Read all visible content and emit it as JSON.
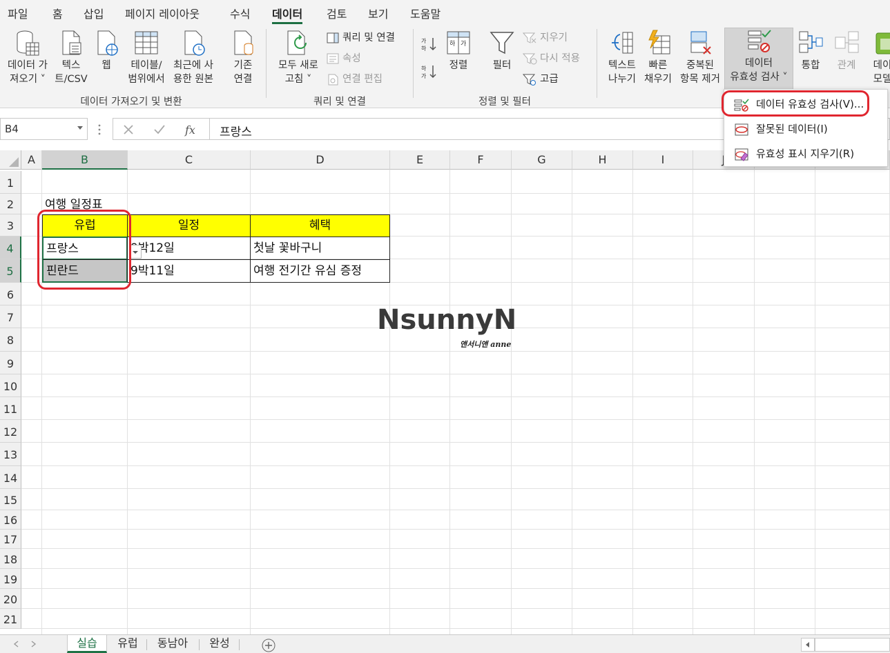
{
  "menu": {
    "tabs": [
      "파일",
      "홈",
      "삽입",
      "페이지 레이아웃",
      "수식",
      "데이터",
      "검토",
      "보기",
      "도움말"
    ],
    "active": "데이터"
  },
  "ribbon": {
    "get_data": [
      "데이터 가",
      "져오기 ˅"
    ],
    "text_csv": [
      "텍스",
      "트/CSV"
    ],
    "web": "웹",
    "table_range": [
      "테이블/",
      "범위에서"
    ],
    "recent_sources": [
      "최근에 사",
      "용한 원본"
    ],
    "existing_conn": [
      "기존",
      "연결"
    ],
    "group_get_transform": "데이터 가져오기 및 변환",
    "refresh_all": [
      "모두 새로",
      "고침 ˅"
    ],
    "queries_conn": "쿼리 및 연결",
    "properties": "속성",
    "edit_links": "연결 편집",
    "group_queries": "쿼리 및 연결",
    "sort": "정렬",
    "filter": "필터",
    "clear": "지우기",
    "reapply": "다시 적용",
    "advanced": "고급",
    "group_sort_filter": "정렬 및 필터",
    "text_to_columns": [
      "텍스트",
      "나누기"
    ],
    "flash_fill": [
      "빠른",
      "채우기"
    ],
    "remove_duplicates": [
      "중복된",
      "항목 제거"
    ],
    "data_validation": [
      "데이터",
      "유효성 검사 ˅"
    ],
    "consolidate": "통합",
    "relationships": "관계",
    "data_model": [
      "데이",
      "모델"
    ]
  },
  "formula_bar": {
    "name_box": "B4",
    "formula": "프랑스"
  },
  "columns": [
    "A",
    "B",
    "C",
    "D",
    "E",
    "F",
    "G",
    "H",
    "I",
    "J"
  ],
  "rows": [
    "1",
    "2",
    "3",
    "4",
    "5",
    "6",
    "7",
    "8",
    "9",
    "10",
    "11",
    "12",
    "13",
    "14",
    "15",
    "16",
    "17",
    "18",
    "19",
    "20",
    "21"
  ],
  "sheet": {
    "title": "여행 일정표",
    "headers": [
      "유럽",
      "일정",
      "혜택"
    ],
    "rows": [
      [
        "프랑스",
        "9박12일",
        "첫날 꽃바구니"
      ],
      [
        "핀란드",
        "9박11일",
        "여행 전기간 유심 증정"
      ]
    ]
  },
  "watermark": {
    "logo": "NsunnyN",
    "tagline": "앤서니앤 anne"
  },
  "validation_menu": {
    "items": [
      "데이터 유효성 검사(V)...",
      "잘못된 데이터(I)",
      "유효성 표시 지우기(R)"
    ]
  },
  "sheet_tabs": [
    "실습",
    "유럽",
    "동남아",
    "완성"
  ],
  "colors": {
    "header_fill": "#ffff00",
    "excel_green": "#1e7145",
    "annotation": "#e0262f"
  }
}
